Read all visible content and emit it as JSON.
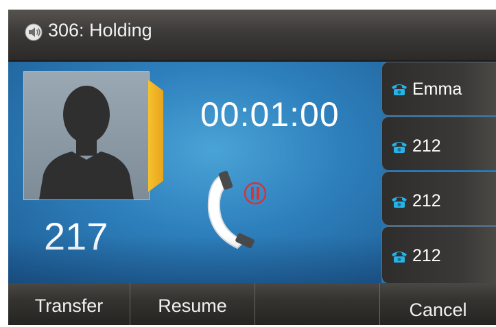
{
  "title_bar": {
    "icon": "speaker-icon",
    "text": "306: Holding"
  },
  "call": {
    "avatar": "person-silhouette",
    "remote_number": "217",
    "duration": "00:01:00",
    "status_icon": "handset-hold-icon"
  },
  "line_keys": [
    {
      "icon": "phone-icon",
      "label": "Emma"
    },
    {
      "icon": "phone-icon",
      "label": "212"
    },
    {
      "icon": "phone-icon",
      "label": "212"
    },
    {
      "icon": "phone-icon",
      "label": "212"
    }
  ],
  "soft_keys": [
    "Transfer",
    "Resume",
    "",
    "Cancel"
  ],
  "colors": {
    "screen_blue": "#2a74ad",
    "accent_yellow": "#f6c12e",
    "phone_icon_cyan": "#26b4e8",
    "hold_red": "#d8323a"
  }
}
